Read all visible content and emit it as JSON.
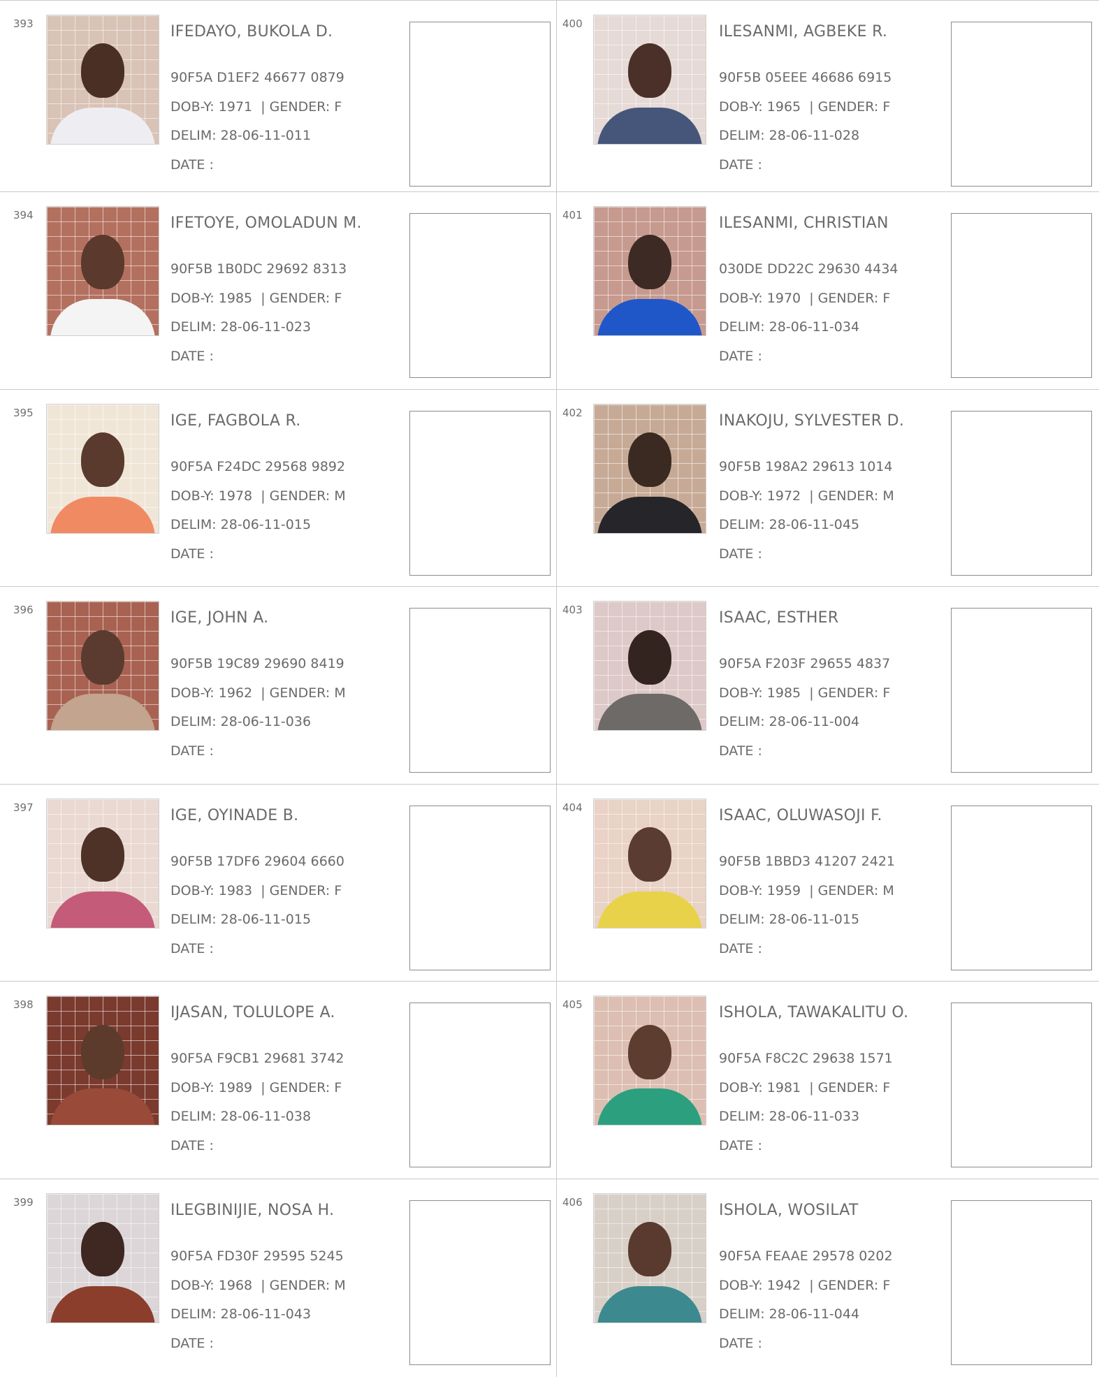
{
  "labels": {
    "dob": "DOB-Y:",
    "gender": "| GENDER:",
    "delim": "DELIM:",
    "date": "DATE :"
  },
  "voters": [
    {
      "serial": "393",
      "name": "IFEDAYO, BUKOLA D.",
      "vin": "90F5A D1EF2 46677 0879",
      "dob_y": "1971",
      "gender": "F",
      "delim": "28-06-11-011",
      "photo_colors": {
        "bg": "#d9c3b6",
        "skin": "#4a2f25",
        "cloth": "#eeeef2"
      }
    },
    {
      "serial": "394",
      "name": "IFETOYE, OMOLADUN M.",
      "vin": "90F5B 1B0DC 29692 8313",
      "dob_y": "1985",
      "gender": "F",
      "delim": "28-06-11-023",
      "photo_colors": {
        "bg": "#b4705f",
        "skin": "#5b3a2d",
        "cloth": "#f4f4f4"
      }
    },
    {
      "serial": "395",
      "name": "IGE, FAGBOLA R.",
      "vin": "90F5A F24DC 29568 9892",
      "dob_y": "1978",
      "gender": "M",
      "delim": "28-06-11-015",
      "photo_colors": {
        "bg": "#f0e6d8",
        "skin": "#5a3a2c",
        "cloth": "#f08a63"
      }
    },
    {
      "serial": "396",
      "name": "IGE, JOHN A.",
      "vin": "90F5B 19C89 29690 8419",
      "dob_y": "1962",
      "gender": "M",
      "delim": "28-06-11-036",
      "photo_colors": {
        "bg": "#a96252",
        "skin": "#5b3b30",
        "cloth": "#c2a48f"
      }
    },
    {
      "serial": "397",
      "name": "IGE, OYINADE B.",
      "vin": "90F5B 17DF6 29604 6660",
      "dob_y": "1983",
      "gender": "F",
      "delim": "28-06-11-015",
      "photo_colors": {
        "bg": "#e9d9d2",
        "skin": "#4e3127",
        "cloth": "#c45b78"
      }
    },
    {
      "serial": "398",
      "name": "IJASAN, TOLULOPE A.",
      "vin": "90F5A F9CB1 29681 3742",
      "dob_y": "1989",
      "gender": "F",
      "delim": "28-06-11-038",
      "photo_colors": {
        "bg": "#7b3a2e",
        "skin": "#5c3b2c",
        "cloth": "#9a4a38"
      }
    },
    {
      "serial": "399",
      "name": "ILEGBINIJIE, NOSA H.",
      "vin": "90F5A FD30F 29595 5245",
      "dob_y": "1968",
      "gender": "M",
      "delim": "28-06-11-043",
      "photo_colors": {
        "bg": "#dcd6d8",
        "skin": "#3f2822",
        "cloth": "#8b3e2c"
      }
    },
    {
      "serial": "400",
      "name": "ILESANMI, AGBEKE R.",
      "vin": "90F5B 05EEE 46686 6915",
      "dob_y": "1965",
      "gender": "F",
      "delim": "28-06-11-028",
      "photo_colors": {
        "bg": "#e6dad6",
        "skin": "#4a3028",
        "cloth": "#46567a"
      }
    },
    {
      "serial": "401",
      "name": "ILESANMI, CHRISTIAN",
      "vin": "030DE DD22C 29630 4434",
      "dob_y": "1970",
      "gender": "F",
      "delim": "28-06-11-034",
      "photo_colors": {
        "bg": "#c79a8f",
        "skin": "#3d2a24",
        "cloth": "#1f57c9"
      }
    },
    {
      "serial": "402",
      "name": "INAKOJU, SYLVESTER D.",
      "vin": "90F5B 198A2 29613 1014",
      "dob_y": "1972",
      "gender": "M",
      "delim": "28-06-11-045",
      "photo_colors": {
        "bg": "#c7aa96",
        "skin": "#3a2a22",
        "cloth": "#26262a"
      }
    },
    {
      "serial": "403",
      "name": "ISAAC, ESTHER",
      "vin": "90F5A F203F 29655 4837",
      "dob_y": "1985",
      "gender": "F",
      "delim": "28-06-11-004",
      "photo_colors": {
        "bg": "#ddc9c8",
        "skin": "#33241f",
        "cloth": "#6e6a68"
      }
    },
    {
      "serial": "404",
      "name": "ISAAC, OLUWASOJI F.",
      "vin": "90F5B 1BBD3 41207 2421",
      "dob_y": "1959",
      "gender": "M",
      "delim": "28-06-11-015",
      "photo_colors": {
        "bg": "#e9d2c6",
        "skin": "#5a3c33",
        "cloth": "#e8d24a"
      }
    },
    {
      "serial": "405",
      "name": "ISHOLA, TAWAKALITU O.",
      "vin": "90F5A F8C2C 29638 1571",
      "dob_y": "1981",
      "gender": "F",
      "delim": "28-06-11-033",
      "photo_colors": {
        "bg": "#dcbfb2",
        "skin": "#5e3d31",
        "cloth": "#2ca07e"
      }
    },
    {
      "serial": "406",
      "name": "ISHOLA, WOSILAT",
      "vin": "90F5A FEAAE 29578 0202",
      "dob_y": "1942",
      "gender": "F",
      "delim": "28-06-11-044",
      "photo_colors": {
        "bg": "#d8cfc7",
        "skin": "#5a3a2e",
        "cloth": "#3c8a8f"
      }
    }
  ]
}
